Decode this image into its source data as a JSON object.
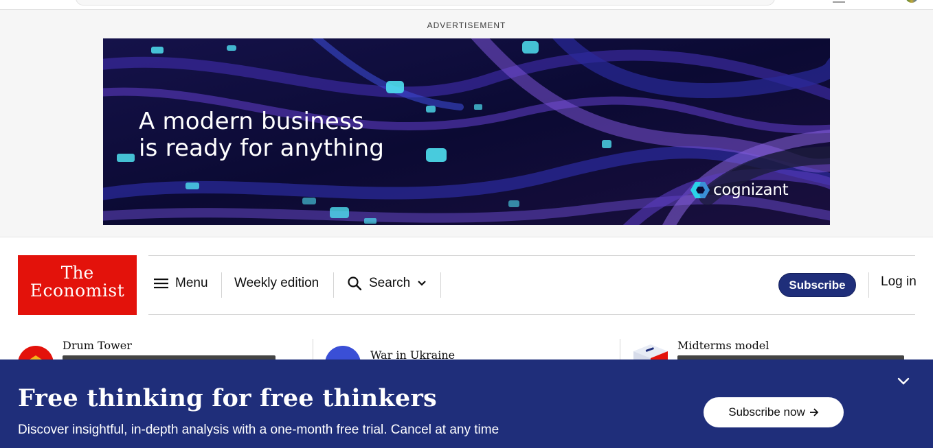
{
  "ad": {
    "label": "ADVERTISEMENT",
    "headline_line1": "A modern business",
    "headline_line2": "is ready for anything",
    "brand": "cognizant"
  },
  "header": {
    "logo_line1": "The",
    "logo_line2": "Economist",
    "menu_label": "Menu",
    "weekly_label": "Weekly edition",
    "search_label": "Search",
    "subscribe_label": "Subscribe",
    "login_label": "Log in"
  },
  "topics": [
    {
      "title": "Drum Tower"
    },
    {
      "title": "War in Ukraine"
    },
    {
      "title": "Midterms model"
    }
  ],
  "promo": {
    "title": "Free thinking for free thinkers",
    "subtitle": "Discover insightful, in-depth analysis with a one-month free trial. Cancel at any time",
    "button_label": "Subscribe now"
  },
  "colors": {
    "brand_red": "#e3120b",
    "navy": "#1f2e7a"
  },
  "icons": {
    "menu": "hamburger-icon",
    "search": "search-icon",
    "chevron": "chevron-down-icon",
    "arrow": "arrow-right-icon",
    "collapse": "chevron-down-icon"
  }
}
